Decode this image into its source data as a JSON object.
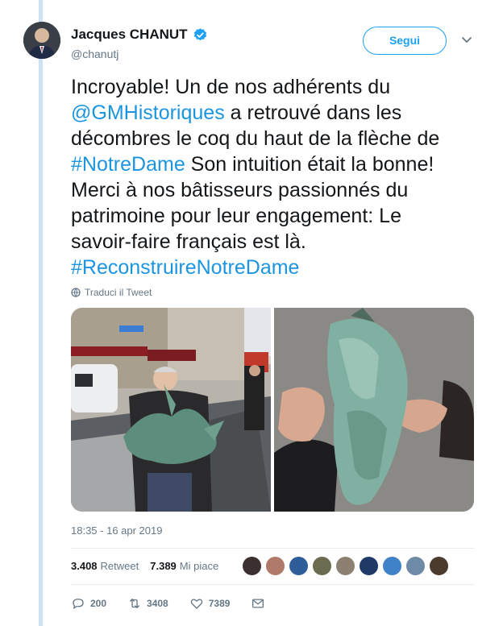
{
  "author": {
    "name": "Jacques CHANUT",
    "handle": "@chanutj",
    "verified": true
  },
  "follow_button": {
    "label": "Segui"
  },
  "tweet": {
    "text_parts": [
      {
        "text": "Incroyable! Un de nos adhérents du ",
        "type": "text"
      },
      {
        "text": "@GMHistoriques",
        "type": "link"
      },
      {
        "text": " a retrouvé dans les décombres  le coq du haut de la flèche de ",
        "type": "text"
      },
      {
        "text": "#NotreDame",
        "type": "link"
      },
      {
        "text": " Son intuition était la bonne! Merci à nos bâtisseurs passionnés du patrimoine pour leur engagement: Le savoir-faire français est là. ",
        "type": "text"
      },
      {
        "text": "#ReconstruireNotreDame",
        "type": "link"
      }
    ],
    "translate_label": "Traduci il Tweet",
    "timestamp": "18:35 - 16 apr 2019"
  },
  "stats": {
    "retweets_count": "3.408",
    "retweets_label": "Retweet",
    "likes_count": "7.389",
    "likes_label": "Mi piace"
  },
  "actions": {
    "replies": "200",
    "retweets": "3408",
    "likes": "7389"
  },
  "colors": {
    "accent": "#1da1f2",
    "link": "#1b95e0",
    "muted": "#657786",
    "thread_line": "#cfe2f3"
  }
}
